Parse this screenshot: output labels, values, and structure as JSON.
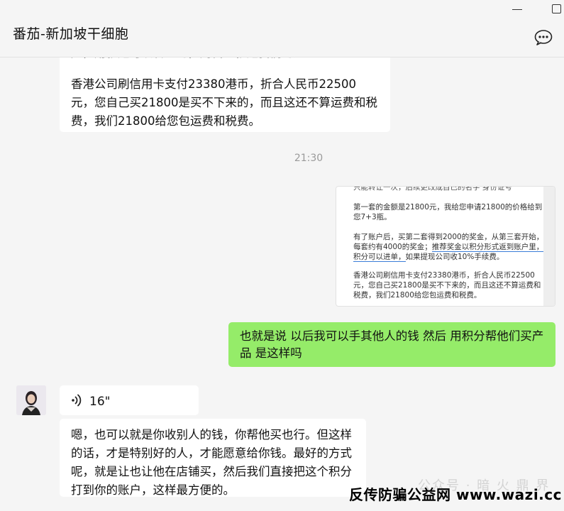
{
  "window": {
    "title": "番茄-新加坡干细胞"
  },
  "messages": {
    "m1_partial": "户，用就是可以转让的，则代理就是我们的人",
    "m1_text": "香港公司刷信用卡支付23380港币，折合人民币22500元，您自己买21800是买不下来的，而且这还不算运费和税费，我们21800给您包运费和税费。",
    "time": "21:30",
    "image": {
      "line0": "只能转让一次，后续更改成自己的名字 身份证号",
      "p1": "第一套的金额是21800元，我给您申请21800的价格给到您7+3瓶。",
      "p2_a": "有了账户后，买第二套得到2000的奖金，从第三套开始，每套约有4000的奖金；",
      "p2_u": "推荐奖金以积分形式返到账户里，积分可以进单，",
      "p2_b": "如果提现公司收10%手续费。",
      "p3": "香港公司刷信用卡支付23380港币，折合人民币22500元，您自己买21800是买不下来的，而且这还不算运费和税费，我们21800给您包运费和税费。"
    },
    "outgoing": "也就是说   以后我可以手其他人的钱   然后   用积分帮他们买产品  是这样吗",
    "voice_duration": "16\"",
    "reply": "嗯，也可以就是你收别人的钱，你帮他买也行。但这样的话，才是特别好的人，才能愿意给你钱。最好的方式呢，就是让也让他在店铺买，然后我们直接把这个积分打到你的账户，这样最方便的。"
  },
  "overlay": {
    "watermark": "公众号 · 暗 火 鼎 界",
    "brand": "反传防骗公益网 www.wazi.cc"
  },
  "icons": {
    "more": "chat-bubble-dots-icon",
    "voice": "sound-wave-icon",
    "minimize": "minimize-icon",
    "maximize": "maximize-icon"
  }
}
